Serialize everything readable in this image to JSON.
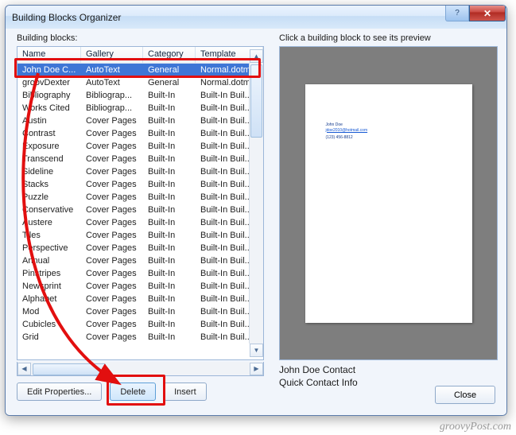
{
  "window": {
    "title": "Building Blocks Organizer"
  },
  "labels": {
    "building_blocks": "Building blocks:",
    "preview_hint": "Click a building block to see its preview"
  },
  "columns": {
    "name": "Name",
    "gallery": "Gallery",
    "category": "Category",
    "template": "Template"
  },
  "rows": [
    {
      "name": "John Doe C...",
      "gallery": "AutoText",
      "category": "General",
      "template": "Normal.dotm",
      "selected": true
    },
    {
      "name": "groovDexter",
      "gallery": "AutoText",
      "category": "General",
      "template": "Normal.dotm"
    },
    {
      "name": "Bibliography",
      "gallery": "Bibliograp...",
      "category": "Built-In",
      "template": "Built-In Buil..."
    },
    {
      "name": "Works Cited",
      "gallery": "Bibliograp...",
      "category": "Built-In",
      "template": "Built-In Buil..."
    },
    {
      "name": "Austin",
      "gallery": "Cover Pages",
      "category": "Built-In",
      "template": "Built-In Buil..."
    },
    {
      "name": "Contrast",
      "gallery": "Cover Pages",
      "category": "Built-In",
      "template": "Built-In Buil..."
    },
    {
      "name": "Exposure",
      "gallery": "Cover Pages",
      "category": "Built-In",
      "template": "Built-In Buil..."
    },
    {
      "name": "Transcend",
      "gallery": "Cover Pages",
      "category": "Built-In",
      "template": "Built-In Buil..."
    },
    {
      "name": "Sideline",
      "gallery": "Cover Pages",
      "category": "Built-In",
      "template": "Built-In Buil..."
    },
    {
      "name": "Stacks",
      "gallery": "Cover Pages",
      "category": "Built-In",
      "template": "Built-In Buil..."
    },
    {
      "name": "Puzzle",
      "gallery": "Cover Pages",
      "category": "Built-In",
      "template": "Built-In Buil..."
    },
    {
      "name": "Conservative",
      "gallery": "Cover Pages",
      "category": "Built-In",
      "template": "Built-In Buil..."
    },
    {
      "name": "Austere",
      "gallery": "Cover Pages",
      "category": "Built-In",
      "template": "Built-In Buil..."
    },
    {
      "name": "Tiles",
      "gallery": "Cover Pages",
      "category": "Built-In",
      "template": "Built-In Buil..."
    },
    {
      "name": "Perspective",
      "gallery": "Cover Pages",
      "category": "Built-In",
      "template": "Built-In Buil..."
    },
    {
      "name": "Annual",
      "gallery": "Cover Pages",
      "category": "Built-In",
      "template": "Built-In Buil..."
    },
    {
      "name": "Pinstripes",
      "gallery": "Cover Pages",
      "category": "Built-In",
      "template": "Built-In Buil..."
    },
    {
      "name": "Newsprint",
      "gallery": "Cover Pages",
      "category": "Built-In",
      "template": "Built-In Buil..."
    },
    {
      "name": "Alphabet",
      "gallery": "Cover Pages",
      "category": "Built-In",
      "template": "Built-In Buil..."
    },
    {
      "name": "Mod",
      "gallery": "Cover Pages",
      "category": "Built-In",
      "template": "Built-In Buil..."
    },
    {
      "name": "Cubicles",
      "gallery": "Cover Pages",
      "category": "Built-In",
      "template": "Built-In Buil..."
    },
    {
      "name": "Grid",
      "gallery": "Cover Pages",
      "category": "Built-In",
      "template": "Built-In Buil..."
    }
  ],
  "preview": {
    "tiny1": "John Doe",
    "tiny2": "jdoe2010@hotmail.com",
    "tiny3": "(123) 456-8812",
    "meta1": "John Doe Contact",
    "meta2": "Quick Contact Info"
  },
  "buttons": {
    "edit_properties": "Edit Properties...",
    "delete": "Delete",
    "insert": "Insert",
    "close": "Close"
  },
  "watermark": "groovyPost.com"
}
